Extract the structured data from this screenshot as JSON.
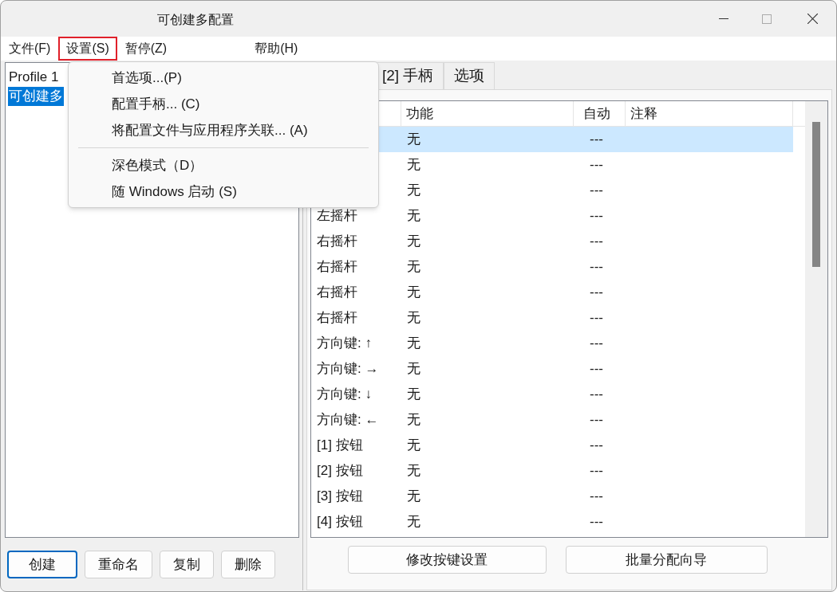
{
  "window": {
    "title": "可创建多配置"
  },
  "menu_bar": [
    {
      "label": "文件(F)",
      "selected": false
    },
    {
      "label": "设置(S)",
      "selected": true
    },
    {
      "label": "暂停(Z)",
      "selected": false
    },
    {
      "label": "帮助(H)",
      "selected": false
    }
  ],
  "dropdown": [
    {
      "kind": "item",
      "label": "首选项...(P)"
    },
    {
      "kind": "item",
      "label": "配置手柄... (C)"
    },
    {
      "kind": "item",
      "label": "将配置文件与应用程序关联... (A)"
    },
    {
      "kind": "separator"
    },
    {
      "kind": "item",
      "label": "深色模式（D）"
    },
    {
      "kind": "item",
      "label": "随 Windows 启动 (S)"
    }
  ],
  "profiles": [
    {
      "label": "Profile 1",
      "selected": false
    },
    {
      "label": "可创建多",
      "selected": true
    }
  ],
  "profile_buttons": [
    {
      "label": "创建",
      "selected": true
    },
    {
      "label": "重命名",
      "selected": false
    },
    {
      "label": "复制",
      "selected": false
    },
    {
      "label": "删除",
      "selected": false
    }
  ],
  "tabs": [
    {
      "label": "[2] 手柄"
    },
    {
      "label": "选项"
    }
  ],
  "table": {
    "columns": [
      "功能",
      "自动",
      "注释"
    ],
    "rows": [
      {
        "function": "无",
        "auto": "---",
        "selected": true
      },
      {
        "function": "无",
        "auto": "---",
        "selected": false
      },
      {
        "function": "无",
        "auto": "---",
        "selected": false
      },
      {
        "input": "左摇杆",
        "function": "无",
        "auto": "---",
        "selected": false
      },
      {
        "input": "右摇杆",
        "function": "无",
        "auto": "---",
        "selected": false
      },
      {
        "input": "右摇杆",
        "function": "无",
        "auto": "---",
        "selected": false
      },
      {
        "input": "右摇杆",
        "function": "无",
        "auto": "---",
        "selected": false
      },
      {
        "input": "右摇杆",
        "function": "无",
        "auto": "---",
        "selected": false
      },
      {
        "input": "方向键: ↑",
        "function": "无",
        "auto": "---",
        "selected": false
      },
      {
        "input": "方向键: →",
        "function": "无",
        "auto": "---",
        "selected": false
      },
      {
        "input": "方向键: ↓",
        "function": "无",
        "auto": "---",
        "selected": false
      },
      {
        "input": "方向键: ←",
        "function": "无",
        "auto": "---",
        "selected": false
      },
      {
        "input": "[1] 按钮",
        "function": "无",
        "auto": "---",
        "selected": false
      },
      {
        "input": "[2] 按钮",
        "function": "无",
        "auto": "---",
        "selected": false
      },
      {
        "input": "[3] 按钮",
        "function": "无",
        "auto": "---",
        "selected": false
      },
      {
        "input": "[4] 按钮",
        "function": "无",
        "auto": "---",
        "selected": false
      }
    ]
  },
  "action_buttons": [
    "修改按键设置",
    "批量分配向导"
  ]
}
